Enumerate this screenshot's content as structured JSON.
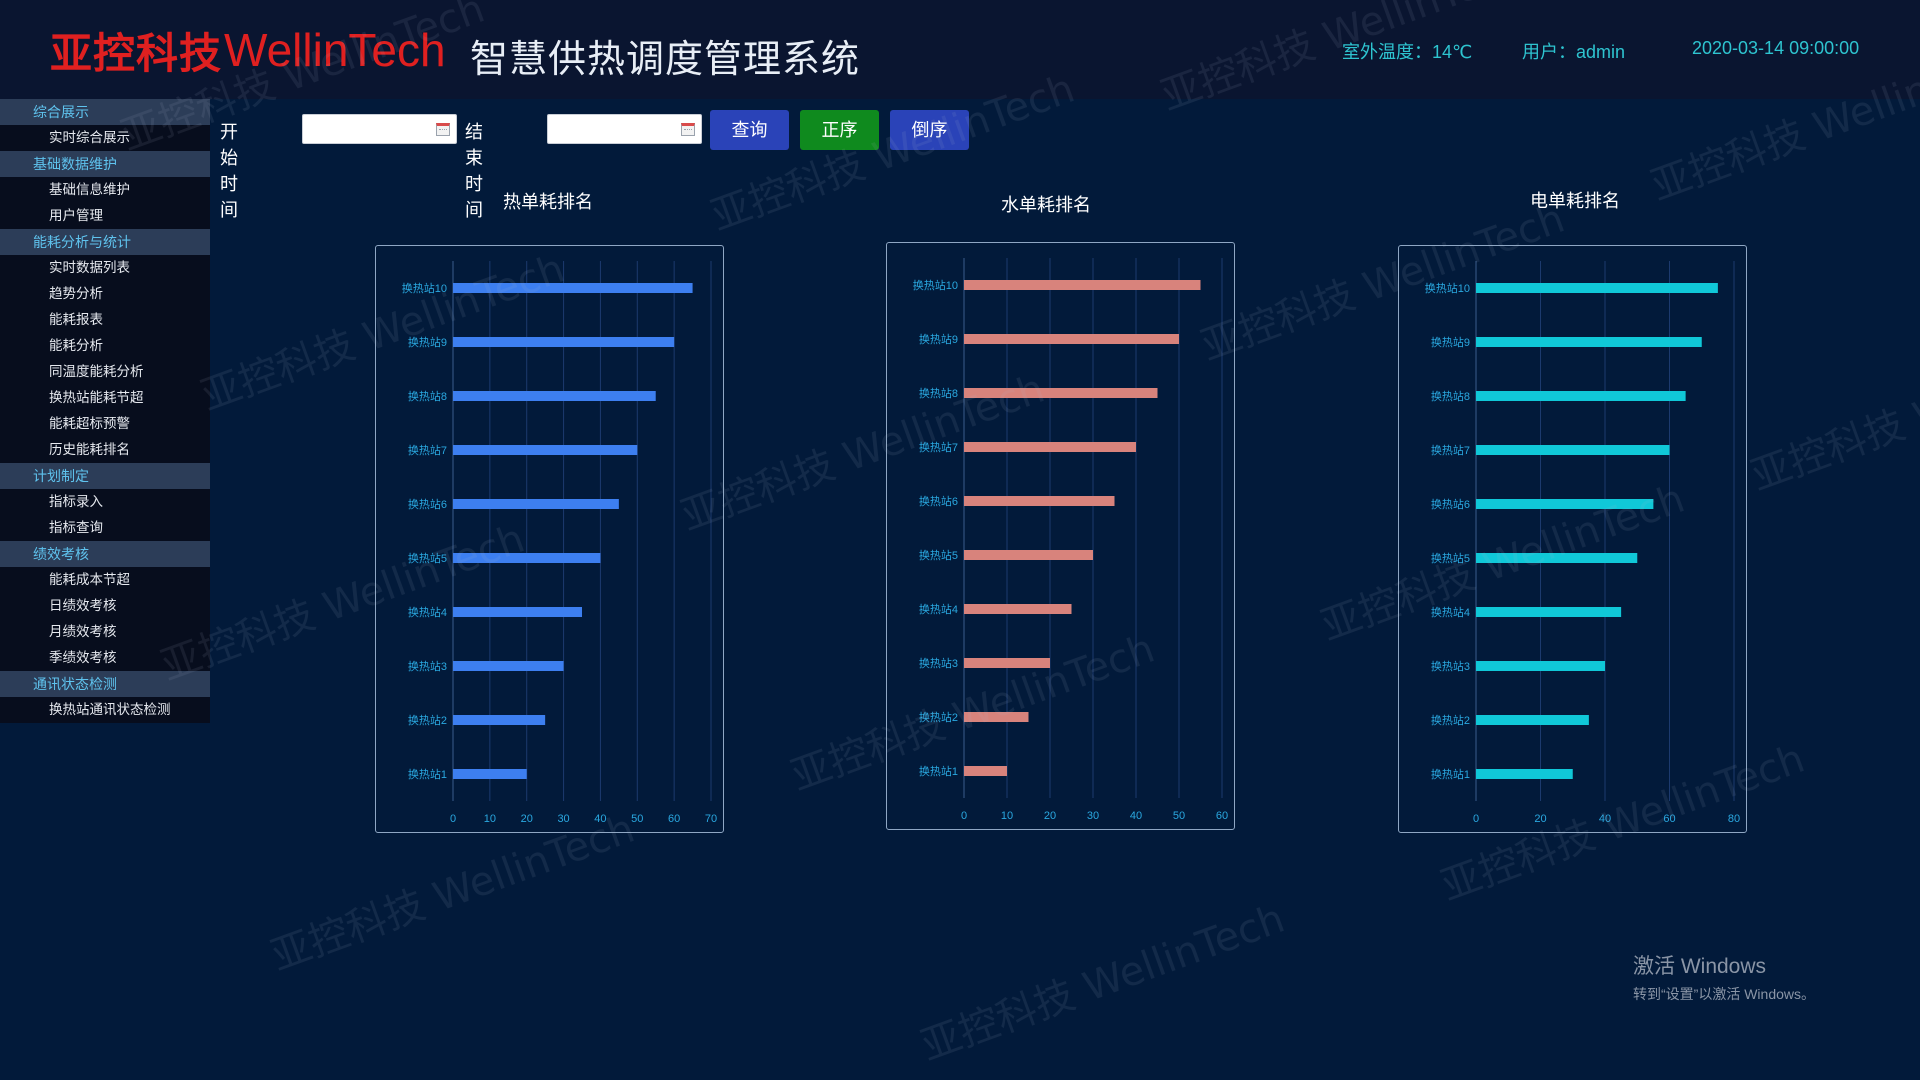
{
  "header": {
    "logo_cn": "亚控科技",
    "logo_en": "WellinTech",
    "title": "智慧供热调度管理系统",
    "temperature": "室外温度：14℃",
    "user": "用户：admin",
    "datetime": "2020-03-14 09:00:00"
  },
  "sidebar": {
    "groups": [
      {
        "label": "综合展示",
        "items": [
          "实时综合展示"
        ]
      },
      {
        "label": "基础数据维护",
        "items": [
          "基础信息维护",
          "用户管理"
        ]
      },
      {
        "label": "能耗分析与统计",
        "items": [
          "实时数据列表",
          "趋势分析",
          "能耗报表",
          "能耗分析",
          "同温度能耗分析",
          "换热站能耗节超",
          "能耗超标预警",
          "历史能耗排名"
        ]
      },
      {
        "label": "计划制定",
        "items": [
          "指标录入",
          "指标查询"
        ]
      },
      {
        "label": "绩效考核",
        "items": [
          "能耗成本节超",
          "日绩效考核",
          "月绩效考核",
          "季绩效考核"
        ]
      },
      {
        "label": "通讯状态检测",
        "items": [
          "换热站通讯状态检测"
        ]
      }
    ]
  },
  "toolbar": {
    "start_label": "开始时间",
    "start_value": "",
    "end_label": "结束时间",
    "end_value": "",
    "query_label": "查询",
    "asc_label": "正序",
    "desc_label": "倒序"
  },
  "colors": {
    "heat": "#3d7ff0",
    "water": "#d8837c",
    "power": "#10c8d8",
    "query_button": "#2a43b8",
    "asc_button": "#0f8a1e",
    "desc_button": "#2a43b8"
  },
  "chart_data": [
    {
      "type": "bar",
      "orientation": "horizontal",
      "title": "热单耗排名",
      "categories": [
        "换热站1",
        "换热站2",
        "换热站3",
        "换热站4",
        "换热站5",
        "换热站6",
        "换热站7",
        "换热站8",
        "换热站9",
        "换热站10"
      ],
      "values": [
        20,
        25,
        30,
        35,
        40,
        45,
        50,
        55,
        60,
        65
      ],
      "xlim": [
        0,
        70
      ],
      "xticks": [
        0,
        10,
        20,
        30,
        40,
        50,
        60,
        70
      ],
      "grid": true,
      "color": "#3d7ff0"
    },
    {
      "type": "bar",
      "orientation": "horizontal",
      "title": "水单耗排名",
      "categories": [
        "换热站1",
        "换热站2",
        "换热站3",
        "换热站4",
        "换热站5",
        "换热站6",
        "换热站7",
        "换热站8",
        "换热站9",
        "换热站10"
      ],
      "values": [
        10,
        15,
        20,
        25,
        30,
        35,
        40,
        45,
        50,
        55
      ],
      "xlim": [
        0,
        60
      ],
      "xticks": [
        0,
        10,
        20,
        30,
        40,
        50,
        60
      ],
      "grid": true,
      "color": "#d8837c"
    },
    {
      "type": "bar",
      "orientation": "horizontal",
      "title": "电单耗排名",
      "categories": [
        "换热站1",
        "换热站2",
        "换热站3",
        "换热站4",
        "换热站5",
        "换热站6",
        "换热站7",
        "换热站8",
        "换热站9",
        "换热站10"
      ],
      "values": [
        30,
        35,
        40,
        45,
        50,
        55,
        60,
        65,
        70,
        75
      ],
      "xlim": [
        0,
        80
      ],
      "xticks": [
        0,
        20,
        40,
        60,
        80
      ],
      "grid": true,
      "color": "#10c8d8"
    }
  ],
  "watermark": "亚控科技 WellinTech",
  "windows_activation": {
    "line1": "激活 Windows",
    "line2": "转到“设置”以激活 Windows。"
  }
}
